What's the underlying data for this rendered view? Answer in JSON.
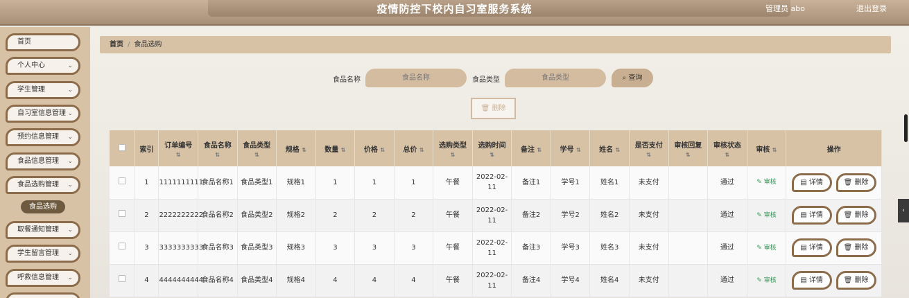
{
  "header": {
    "title": "疫情防控下校内自习室服务系统",
    "user": "管理员 abo",
    "logout": "退出登录"
  },
  "sidebar": {
    "items": [
      {
        "label": "首页",
        "chev": ""
      },
      {
        "label": "个人中心",
        "chev": "⌄"
      },
      {
        "label": "学生管理",
        "chev": "⌄"
      },
      {
        "label": "自习室信息管理",
        "chev": "⌄"
      },
      {
        "label": "预约信息管理",
        "chev": "⌄"
      },
      {
        "label": "食品信息管理",
        "chev": "⌄"
      },
      {
        "label": "食品选购管理",
        "chev": "⌄"
      },
      {
        "label": "取餐通知管理",
        "chev": "⌄"
      },
      {
        "label": "学生留言管理",
        "chev": "⌄"
      },
      {
        "label": "呼救信息管理",
        "chev": "⌄"
      }
    ],
    "active_sub": "食品选购"
  },
  "breadcrumb": {
    "home": "首页",
    "sep": "/",
    "current": "食品选购"
  },
  "search": {
    "name_label": "食品名称",
    "name_placeholder": "食品名称",
    "type_label": "食品类型",
    "type_placeholder": "食品类型",
    "query_label": "查询",
    "delete_label": "删除"
  },
  "table": {
    "headers": [
      "索引",
      "订单编号",
      "食品名称",
      "食品类型",
      "规格",
      "数量",
      "价格",
      "总价",
      "选购类型",
      "选购时间",
      "备注",
      "学号",
      "姓名",
      "是否支付",
      "审核回复",
      "审核状态",
      "审核",
      "操作"
    ],
    "rows": [
      {
        "index": "1",
        "order": "1111111111",
        "name": "食品名称1",
        "type": "食品类型1",
        "spec": "规格1",
        "qty": "1",
        "price": "1",
        "total": "1",
        "buy_type": "午餐",
        "time": "2022-02-11",
        "note": "备注1",
        "sid": "学号1",
        "sname": "姓名1",
        "paid": "未支付",
        "reply": "",
        "status": "通过",
        "audit": "审核",
        "detail": "详情",
        "del": "删除"
      },
      {
        "index": "2",
        "order": "2222222222",
        "name": "食品名称2",
        "type": "食品类型2",
        "spec": "规格2",
        "qty": "2",
        "price": "2",
        "total": "2",
        "buy_type": "午餐",
        "time": "2022-02-11",
        "note": "备注2",
        "sid": "学号2",
        "sname": "姓名2",
        "paid": "未支付",
        "reply": "",
        "status": "通过",
        "audit": "审核",
        "detail": "详情",
        "del": "删除"
      },
      {
        "index": "3",
        "order": "3333333333",
        "name": "食品名称3",
        "type": "食品类型3",
        "spec": "规格3",
        "qty": "3",
        "price": "3",
        "total": "3",
        "buy_type": "午餐",
        "time": "2022-02-11",
        "note": "备注3",
        "sid": "学号3",
        "sname": "姓名3",
        "paid": "未支付",
        "reply": "",
        "status": "通过",
        "audit": "审核",
        "detail": "详情",
        "del": "删除"
      },
      {
        "index": "4",
        "order": "4444444444",
        "name": "食品名称4",
        "type": "食品类型4",
        "spec": "规格4",
        "qty": "4",
        "price": "4",
        "total": "4",
        "buy_type": "午餐",
        "time": "2022-02-11",
        "note": "备注4",
        "sid": "学号4",
        "sname": "姓名4",
        "paid": "未支付",
        "reply": "",
        "status": "通过",
        "audit": "审核",
        "detail": "详情",
        "del": "删除"
      }
    ]
  },
  "colors": {
    "accent": "#8c6c4a",
    "sidebar_bg": "#d8c2a6",
    "audit_green": "#3a9a5c"
  }
}
